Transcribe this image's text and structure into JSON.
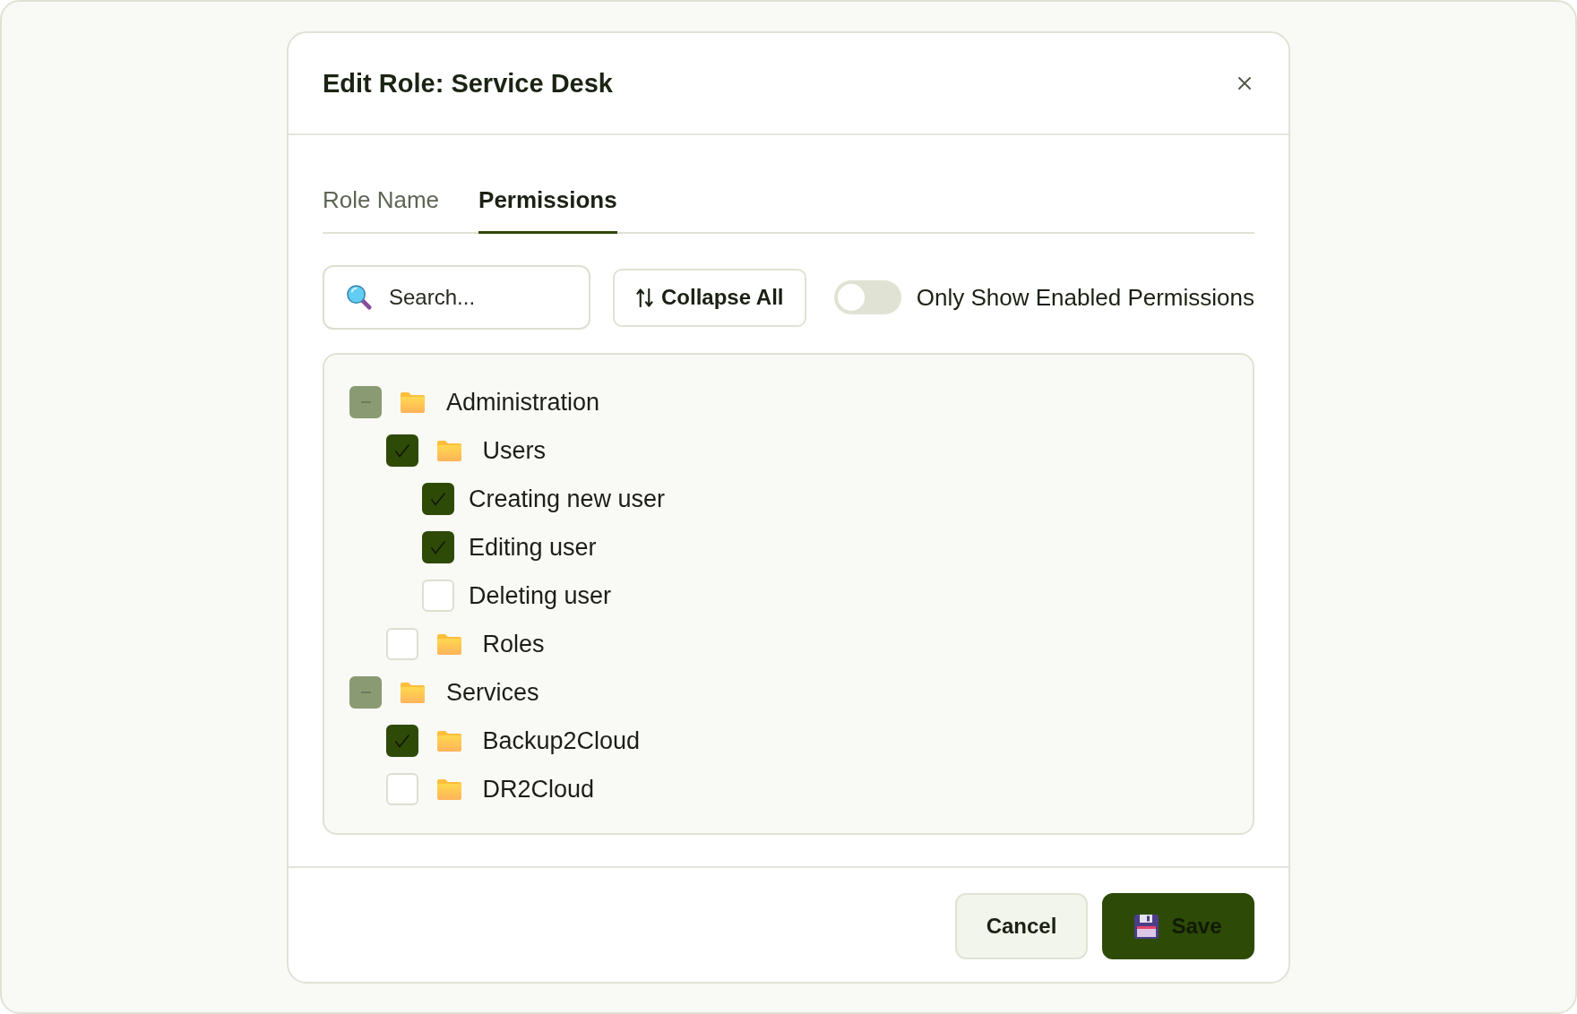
{
  "dialog": {
    "title": "Edit Role: Service Desk"
  },
  "tabs": [
    {
      "label": "Role Name",
      "selected": false
    },
    {
      "label": "Permissions",
      "selected": true
    }
  ],
  "search": {
    "placeholder": "Search..."
  },
  "collapse_button": {
    "label": "Collapse All"
  },
  "filter_toggle": {
    "label": "Only Show Enabled Permissions",
    "on": false
  },
  "permission_tree": [
    {
      "label": "Administration",
      "kind": "folder",
      "checked": false,
      "indeterminate": true,
      "children": [
        {
          "label": "Users",
          "kind": "folder",
          "checked": true,
          "indeterminate": false,
          "children": [
            {
              "label": "Creating new user",
              "kind": "permission",
              "checked": true,
              "indeterminate": false
            },
            {
              "label": "Editing user",
              "kind": "permission",
              "checked": true,
              "indeterminate": false
            },
            {
              "label": "Deleting user",
              "kind": "permission",
              "checked": false,
              "indeterminate": false
            }
          ]
        },
        {
          "label": "Roles",
          "kind": "folder",
          "checked": false,
          "indeterminate": false
        }
      ]
    },
    {
      "label": "Services",
      "kind": "folder",
      "checked": false,
      "indeterminate": true,
      "children": [
        {
          "label": "Backup2Cloud",
          "kind": "folder",
          "checked": true,
          "indeterminate": false
        },
        {
          "label": "DR2Cloud",
          "kind": "folder",
          "checked": false,
          "indeterminate": false
        }
      ]
    }
  ],
  "footer": {
    "buttons": [
      {
        "label": "Cancel",
        "kind": "secondary"
      },
      {
        "label": "Save",
        "kind": "primary"
      }
    ]
  }
}
